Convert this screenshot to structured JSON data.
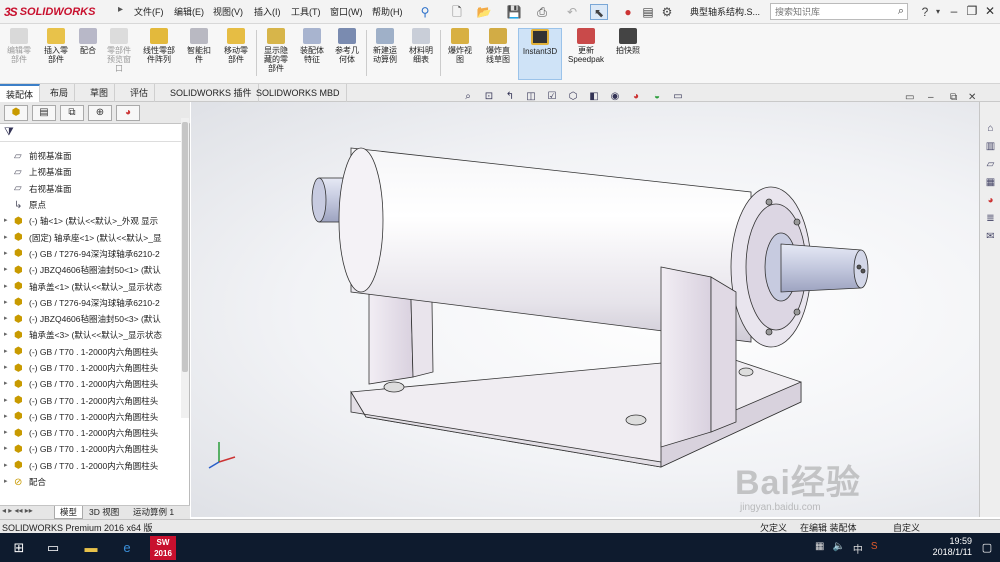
{
  "titlebar": {
    "logo": "SOLIDWORKS",
    "menus": [
      "文件(F)",
      "编辑(E)",
      "视图(V)",
      "插入(I)",
      "工具(T)",
      "窗口(W)",
      "帮助(H)"
    ],
    "doc_title": "典型轴系结构.S...",
    "search_placeholder": "搜索知识库"
  },
  "ribbon": {
    "buttons": [
      {
        "label": "编辑零\n部件",
        "enabled": false
      },
      {
        "label": "插入零\n部件",
        "enabled": true
      },
      {
        "label": "配合",
        "enabled": true
      },
      {
        "label": "零部件\n预览窗\n口",
        "enabled": false
      },
      {
        "label": "线性零部\n件阵列",
        "enabled": true
      },
      {
        "label": "智能扣\n件",
        "enabled": true
      },
      {
        "label": "移动零\n部件",
        "enabled": true
      },
      {
        "label": "显示隐\n藏的零\n部件",
        "enabled": true
      },
      {
        "label": "装配体\n特征",
        "enabled": true
      },
      {
        "label": "参考几\n何体",
        "enabled": true
      },
      {
        "label": "新建运\n动算例",
        "enabled": true
      },
      {
        "label": "材料明\n细表",
        "enabled": true
      },
      {
        "label": "爆炸视\n图",
        "enabled": true
      },
      {
        "label": "爆炸直\n线草图",
        "enabled": true
      },
      {
        "label": "Instant3D",
        "enabled": true
      },
      {
        "label": "更新\nSpeedpak",
        "enabled": true
      },
      {
        "label": "拍快照",
        "enabled": true
      }
    ]
  },
  "command_tabs": [
    "装配体",
    "布局",
    "草图",
    "评估",
    "SOLIDWORKS 插件",
    "SOLIDWORKS MBD"
  ],
  "tree": {
    "items": [
      {
        "label": "前视基准面",
        "type": "plane"
      },
      {
        "label": "上视基准面",
        "type": "plane"
      },
      {
        "label": "右视基准面",
        "type": "plane"
      },
      {
        "label": "原点",
        "type": "origin"
      },
      {
        "label": "(-) 轴<1> (默认<<默认>_外观 显示",
        "type": "part"
      },
      {
        "label": "(固定) 轴承座<1> (默认<<默认>_显",
        "type": "part"
      },
      {
        "label": "(-) GB / T276-94深沟球轴承6210-2",
        "type": "part"
      },
      {
        "label": "(-) JBZQ4606毡圈油封50<1> (默认",
        "type": "part"
      },
      {
        "label": "轴承盖<1> (默认<<默认>_显示状态",
        "type": "part"
      },
      {
        "label": "(-) GB / T276-94深沟球轴承6210-2",
        "type": "part"
      },
      {
        "label": "(-) JBZQ4606毡圈油封50<3> (默认",
        "type": "part"
      },
      {
        "label": "轴承盖<3> (默认<<默认>_显示状态",
        "type": "part"
      },
      {
        "label": "(-) GB / T70 . 1-2000内六角圆柱头",
        "type": "part"
      },
      {
        "label": "(-) GB / T70 . 1-2000内六角圆柱头",
        "type": "part"
      },
      {
        "label": "(-) GB / T70 . 1-2000内六角圆柱头",
        "type": "part"
      },
      {
        "label": "(-) GB / T70 . 1-2000内六角圆柱头",
        "type": "part"
      },
      {
        "label": "(-) GB / T70 . 1-2000内六角圆柱头",
        "type": "part"
      },
      {
        "label": "(-) GB / T70 . 1-2000内六角圆柱头",
        "type": "part"
      },
      {
        "label": "(-) GB / T70 . 1-2000内六角圆柱头",
        "type": "part"
      },
      {
        "label": "(-) GB / T70 . 1-2000内六角圆柱头",
        "type": "part"
      },
      {
        "label": "配合",
        "type": "mates"
      }
    ]
  },
  "bottom_tabs": [
    "模型",
    "3D 视图",
    "运动算例 1"
  ],
  "status": {
    "left": "SOLIDWORKS Premium 2016 x64 版",
    "right1": "欠定义",
    "right2": "在编辑 装配体",
    "right3": "自定义"
  },
  "taskbar": {
    "time": "19:59",
    "date": "2018/1/11",
    "ime": "中",
    "sw_label": "SW\n2016"
  },
  "watermark": {
    "text": "Bai经验",
    "url": "jingyan.baidu.com"
  },
  "colors": {
    "brand": "#c8102e",
    "model_body": "#ede9f0",
    "model_shaft": "#cfd3e6",
    "taskbar": "#0e1b2e"
  }
}
